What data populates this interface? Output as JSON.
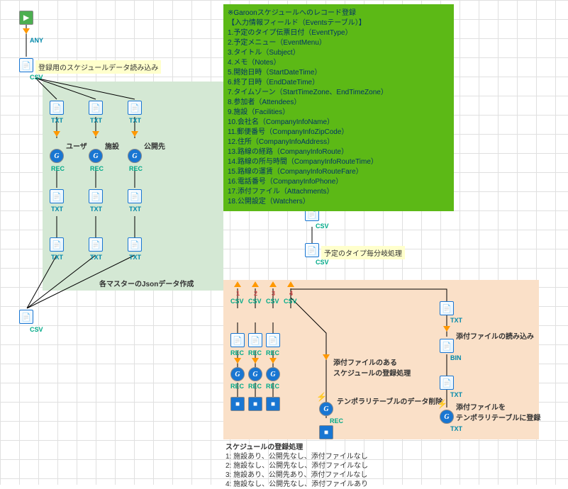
{
  "any_label": "ANY",
  "csv_label": "CSV",
  "txt_label": "TXT",
  "rec_label": "REC",
  "bin_label": "BIN",
  "g_label": "G",
  "yellow_box_1": "登録用のスケジュールデータ読み込み",
  "yellow_box_2": "予定のタイプ毎分岐処理",
  "label_user": "ユーザ",
  "label_facility": "施設",
  "label_public": "公開先",
  "label_master_json": "各マスターのJsonデータ作成",
  "label_attach_schedule": "添付ファイルのある\nスケジュールの登録処理",
  "label_temp_delete": "テンポラリテーブルのデータ削除",
  "label_attach_read": "添付ファイルの読み込み",
  "label_attach_register": "添付ファイルを\nテンポラリテーブルに登録",
  "branches": {
    "n1": "1",
    "n2": "2",
    "n3": "3",
    "n4": "4"
  },
  "green_note": {
    "title": "※Garoonスケジュールへのレコード登録",
    "sub": "【入力情報フィールド（Eventsテーブル）】",
    "items": [
      "1.予定のタイプ伝票日付（EventType）",
      "2.予定メニュー（EventMenu）",
      "3.タイトル（Subject）",
      "4.メモ（Notes）",
      "5.開始日時（StartDateTime）",
      "6.終了日時（EndDateTime）",
      "7.タイムゾーン（StartTimeZone、EndTimeZone）",
      "8.参加者（Attendees）",
      "9.施設（Facilities）",
      "10.会社名（CompanyInfoName）",
      "11.郵便番号（CompanyInfoZipCode）",
      "12.住所（CompanyInfoAddress）",
      "13.路線の経路（CompanyInfoRoute）",
      "14.路線の所与時間（CompanyInfoRouteTime）",
      "15.路線の運賃（CompanyInfoRouteFare）",
      "16.電話番号（CompanyInfoPhone）",
      "17.添付ファイル（Attachments）",
      "18.公開設定（Watchers）"
    ]
  },
  "legend": {
    "title": "スケジュールの登録処理",
    "rows": [
      "1: 施設あり、公開先なし、添付ファイルなし",
      "2: 施設なし、公開先なし、添付ファイルなし",
      "3: 施設あり、公開先あり、添付ファイルなし",
      "4: 施設なし、公開先なし、添付ファイルあり"
    ]
  }
}
